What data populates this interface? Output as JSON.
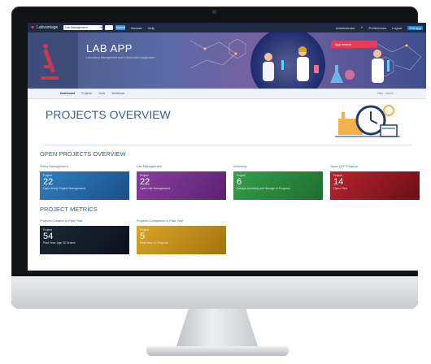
{
  "topnav": {
    "brand": "Labvantage",
    "select_value": "Lab Management",
    "go_label": "Submit",
    "links": [
      "Browse",
      "Help"
    ],
    "right_items": [
      "Administrator",
      "Preferences",
      "Logout"
    ],
    "exit_label": "Exit App"
  },
  "hero": {
    "title": "LAB APP",
    "subtitle": "Laboratory Management and Collaboration Application",
    "badge": "App search"
  },
  "subnav": {
    "items": [
      "Dashboard",
      "Projects",
      "Tools",
      "Workflows"
    ],
    "right": "Help · Admin"
  },
  "main": {
    "title": "PROJECTS OVERVIEW",
    "section_open": "OPEN PROJECTS OVERVIEW",
    "section_metrics": "PROJECT METRICS",
    "open_cards": [
      {
        "label": "Study Management",
        "caption": "Project",
        "value": "22",
        "desc": "Open Study Project Management",
        "color": "#2f7fbf"
      },
      {
        "label": "Lab Management",
        "caption": "Project",
        "value": "22",
        "desc": "Open Lab Management",
        "color": "#8a3fa0"
      },
      {
        "label": "Archiving",
        "caption": "Project",
        "value": "6",
        "desc": "Sample Archiving and Storage in Progress",
        "color": "#33a04a"
      },
      {
        "label": "Open QLP Projects",
        "caption": "Project",
        "value": "14",
        "desc": "Open: Red",
        "color": "#b9232f"
      }
    ],
    "metric_cards": [
      {
        "label": "Projects Created in Past Year",
        "caption": "Project",
        "value": "54",
        "desc": "Past Year: Age 30 Orders",
        "color": "#1c2838"
      },
      {
        "label": "Projects Completed in Past Year",
        "caption": "Project",
        "value": "5",
        "desc": "Past Year: 12 Projects",
        "color": "#d9a52a"
      }
    ]
  }
}
